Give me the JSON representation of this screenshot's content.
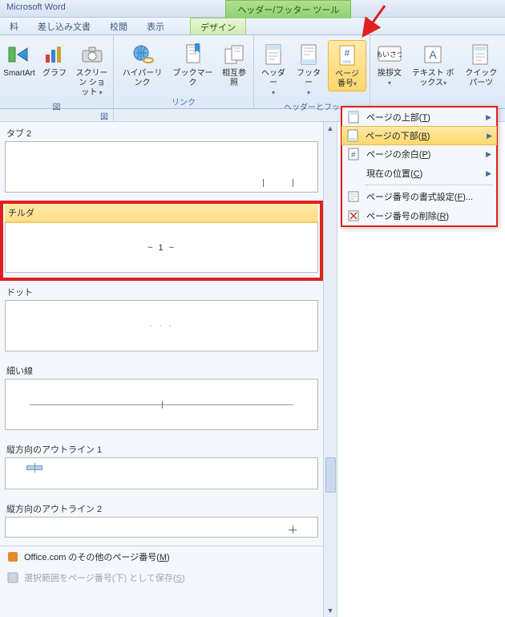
{
  "titlebar": {
    "app": "Microsoft Word",
    "context": "ヘッダー/フッター ツール"
  },
  "tabs": {
    "items": [
      "料",
      "差し込み文書",
      "校閲",
      "表示",
      "デザイン"
    ],
    "active_index": 4
  },
  "ribbon": {
    "groups": {
      "illust_label": "図",
      "links_label": "リンク",
      "hf_label": "ヘッダーとフッ",
      "smartart": "SmartArt",
      "graph": "グラフ",
      "screenshot": "スクリーン\nショット",
      "hyperlink": "ハイパーリンク",
      "bookmark": "ブックマーク",
      "crossref": "相互参照",
      "header": "ヘッダー",
      "footer": "フッター",
      "pagenum": "ページ\n番号",
      "greeting": "挨拶文",
      "textbox": "テキスト\nボックス",
      "quickparts": "クイック パーツ"
    }
  },
  "gallery": {
    "items": {
      "tab2": "タブ 2",
      "tilde": "チルダ",
      "tilde_sample": "~ 1 ~",
      "dot": "ドット",
      "thin": "細い線",
      "outline1": "縦方向のアウトライン 1",
      "outline2": "縦方向のアウトライン 2"
    },
    "footer": {
      "office": "Office.com のその他のページ番号(",
      "office_u": "M",
      "office_end": ")",
      "save_sel": "選択範囲をページ番号(下) として保存(",
      "save_sel_u": "S",
      "save_sel_end": ")"
    }
  },
  "menu": {
    "top": {
      "t": "ページの上部(",
      "u": "T",
      "e": ")"
    },
    "bottom": {
      "t": "ページの下部(",
      "u": "B",
      "e": ")"
    },
    "margin": {
      "t": "ページの余白(",
      "u": "P",
      "e": ")"
    },
    "current": {
      "t": "現在の位置(",
      "u": "C",
      "e": ")"
    },
    "format": {
      "t": "ページ番号の書式設定(",
      "u": "F",
      "e": ")..."
    },
    "remove": {
      "t": "ページ番号の削除(",
      "u": "R",
      "e": ")"
    }
  }
}
